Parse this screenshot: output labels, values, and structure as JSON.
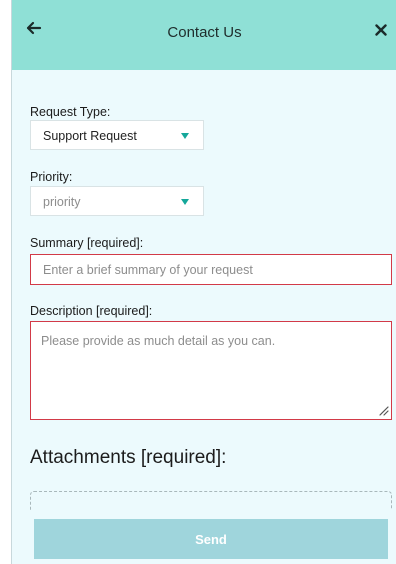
{
  "header": {
    "title": "Contact Us",
    "back_icon": "arrow-left-icon",
    "close_icon": "close-icon",
    "background": "#8fe0d6"
  },
  "form": {
    "request_type": {
      "label": "Request Type:",
      "value": "Support Request"
    },
    "priority": {
      "label": "Priority:",
      "placeholder": "priority"
    },
    "summary": {
      "label": "Summary [required]:",
      "placeholder": "Enter a brief summary of your request"
    },
    "description": {
      "label": "Description [required]:",
      "placeholder": "Please provide as much detail as you can."
    },
    "attachments": {
      "heading": "Attachments [required]:"
    }
  },
  "footer": {
    "send_label": "Send",
    "send_color": "#9fd5dc"
  },
  "colors": {
    "panel_background": "#ecfafd",
    "accent_teal": "#14a79a",
    "required_border": "#d23a48"
  }
}
